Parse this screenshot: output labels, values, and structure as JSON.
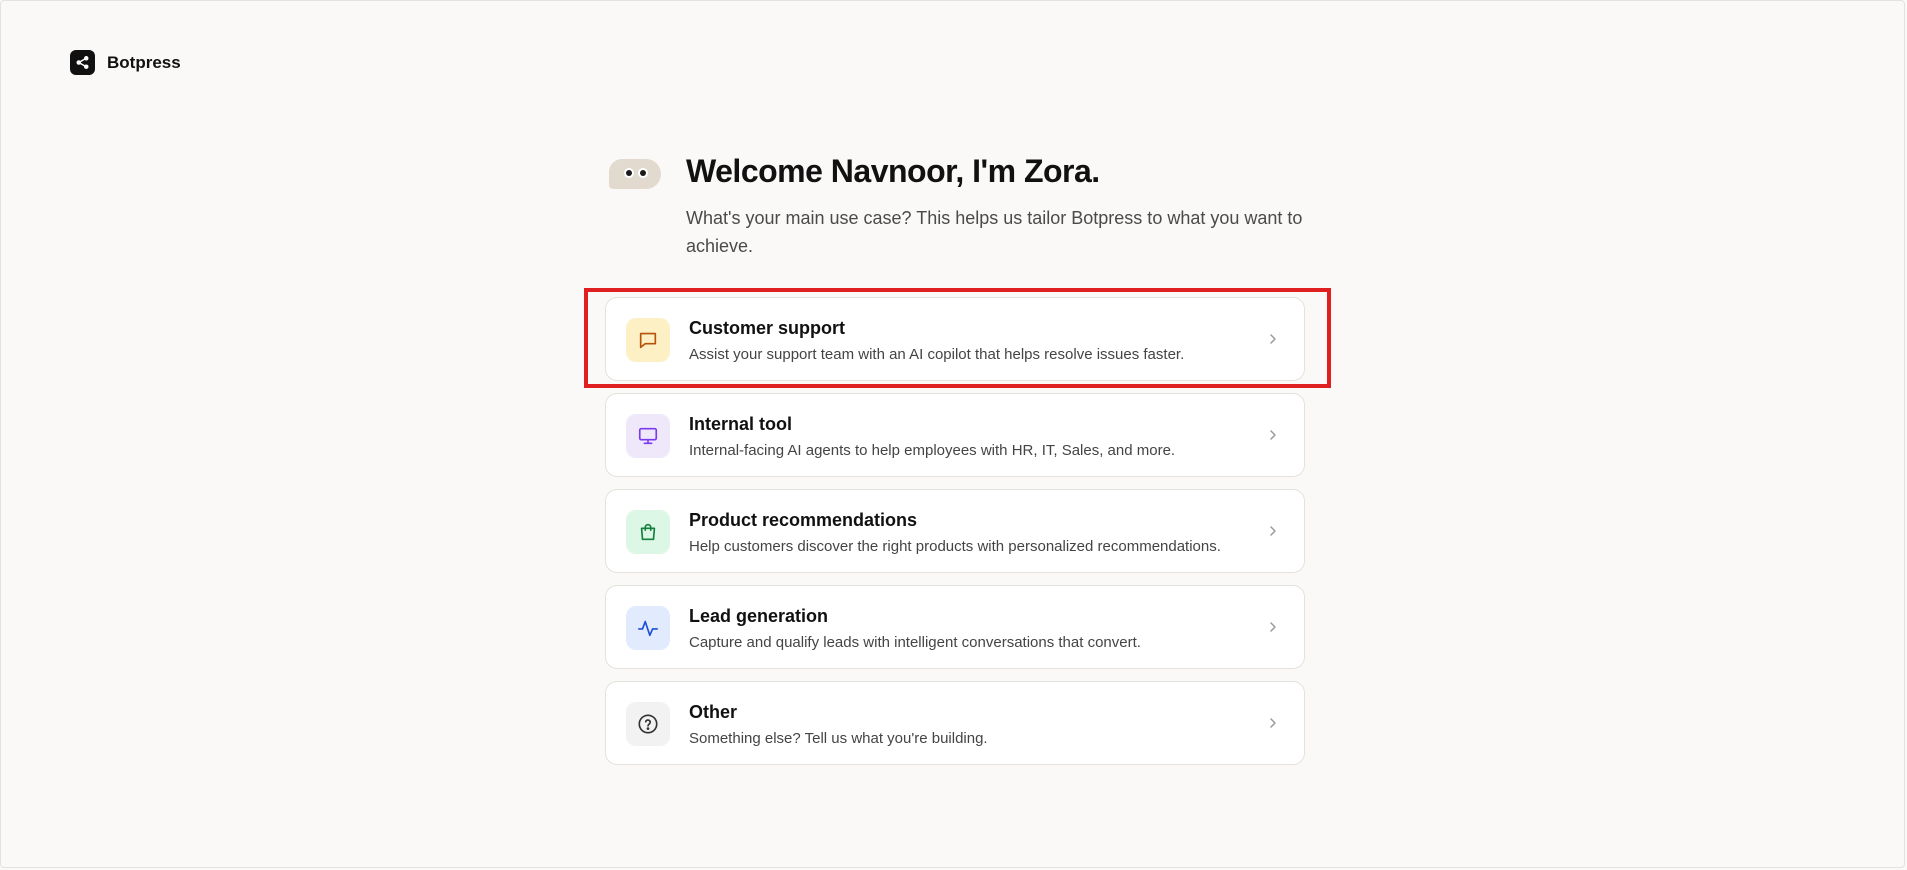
{
  "brand": {
    "name": "Botpress",
    "icon": "share-nodes-icon"
  },
  "welcome": {
    "title": "Welcome Navnoor, I'm Zora.",
    "subtitle": "What's your main use case? This helps us tailor Botpress to what you want to achieve."
  },
  "options": [
    {
      "title": "Customer support",
      "description": "Assist your support team with an AI copilot that helps resolve issues faster.",
      "icon": "chat-bubble-icon",
      "icon_bg": "#fdf0c4",
      "icon_color": "#b45309"
    },
    {
      "title": "Internal tool",
      "description": "Internal-facing AI agents to help employees with HR, IT, Sales, and more.",
      "icon": "monitor-icon",
      "icon_bg": "#efe8fb",
      "icon_color": "#7c3aed"
    },
    {
      "title": "Product recommendations",
      "description": "Help customers discover the right products with personalized recommendations.",
      "icon": "shopping-bag-icon",
      "icon_bg": "#dcf7e6",
      "icon_color": "#15803d"
    },
    {
      "title": "Lead generation",
      "description": "Capture and qualify leads with intelligent conversations that convert.",
      "icon": "activity-icon",
      "icon_bg": "#e1ebfd",
      "icon_color": "#1d4ed8"
    },
    {
      "title": "Other",
      "description": "Something else? Tell us what you're building.",
      "icon": "question-circle-icon",
      "icon_bg": "#f2f2f2",
      "icon_color": "#333333"
    }
  ],
  "highlight_color": "#e02020"
}
